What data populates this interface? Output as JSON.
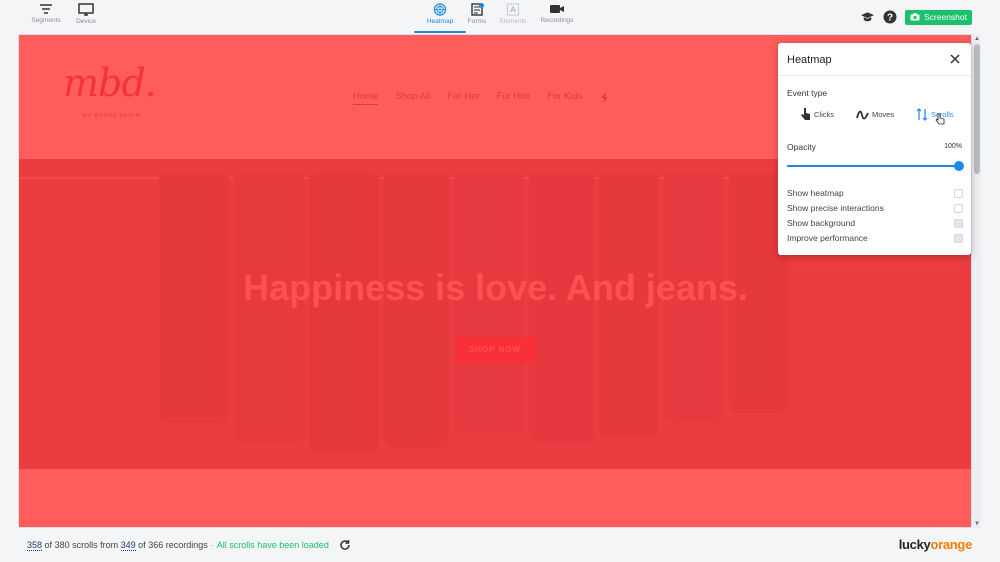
{
  "toolbar": {
    "left": [
      {
        "label": "Segments",
        "icon": "filter-icon"
      },
      {
        "label": "Device",
        "icon": "monitor-icon"
      }
    ],
    "center": [
      {
        "label": "Heatmap",
        "icon": "heatmap-icon",
        "active": true
      },
      {
        "label": "Forms",
        "icon": "forms-icon"
      },
      {
        "label": "Elements",
        "icon": "elements-icon",
        "disabled": true
      },
      {
        "label": "Recordings",
        "icon": "video-camera-icon"
      }
    ],
    "screenshot_label": "Screenshot"
  },
  "site": {
    "logo": "mbd.",
    "logo_sub": "MY BRAND DENIM",
    "nav": [
      "Home",
      "Shop All",
      "For Her",
      "For Him",
      "For Kids"
    ],
    "hero_title": "Happiness is love. And jeans.",
    "hero_button": "SHOP NOW"
  },
  "panel": {
    "title": "Heatmap",
    "event_type_label": "Event type",
    "events": [
      {
        "label": "Clicks",
        "icon": "click-icon"
      },
      {
        "label": "Moves",
        "icon": "moves-icon"
      },
      {
        "label": "Scrolls",
        "icon": "scroll-icon",
        "selected": true
      }
    ],
    "opacity_label": "Opacity",
    "opacity_value": "100%",
    "opacity_fraction": 1.0,
    "options": [
      {
        "label": "Show heatmap",
        "checked": false
      },
      {
        "label": "Show precise interactions",
        "checked": false
      },
      {
        "label": "Show background",
        "checked": true
      },
      {
        "label": "Improve performance",
        "checked": true
      }
    ]
  },
  "status": {
    "scrolls_shown": "358",
    "of_text_1": "of",
    "scrolls_total_text": "380 scrolls from",
    "recordings_shown": "349",
    "of_text_2": "of",
    "recordings_total_text": "366 recordings",
    "separator": "·",
    "loaded_text": "All scrolls have been loaded"
  },
  "brand": {
    "part1": "lucky",
    "part2": "orange"
  },
  "colors": {
    "accent": "#1e88e5",
    "success": "#1bc06b",
    "heat": "#ff3838",
    "brand_orange": "#f57c00"
  }
}
